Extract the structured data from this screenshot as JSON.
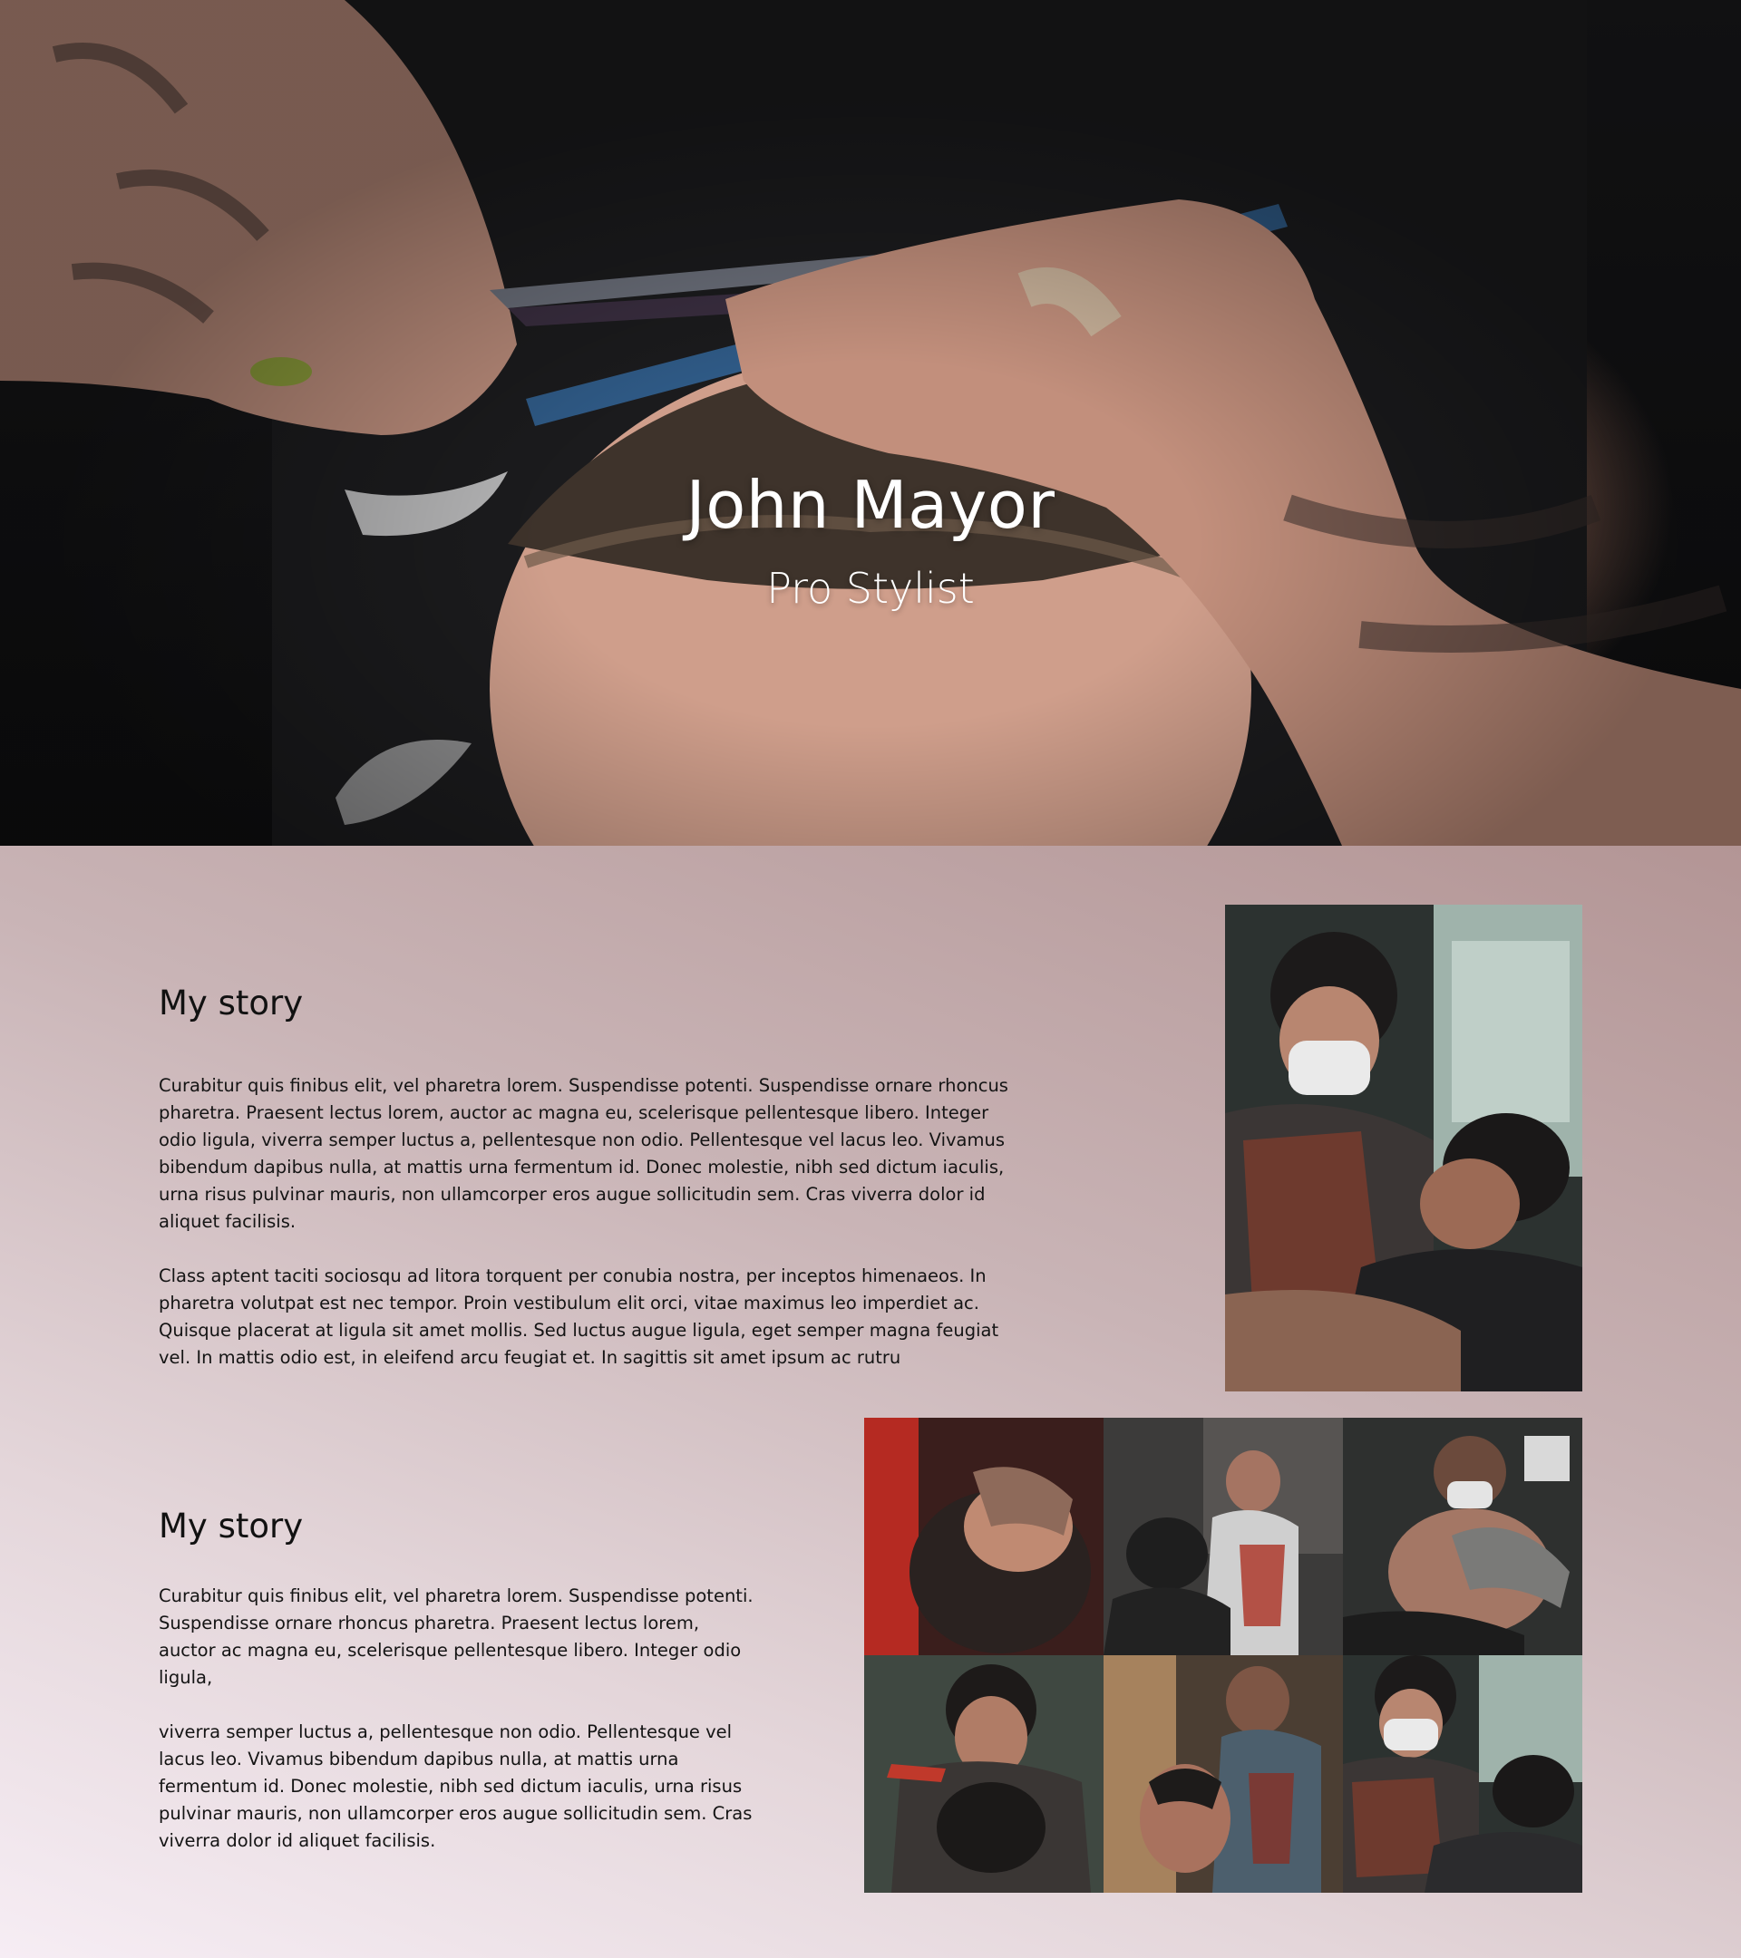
{
  "hero": {
    "title": "John Mayor",
    "subtitle": "Pro Stylist"
  },
  "story_1": {
    "heading": "My story",
    "paragraphs": [
      "Curabitur quis finibus elit, vel pharetra lorem. Suspendisse potenti. Suspendisse ornare rhoncus pharetra. Praesent lectus lorem, auctor ac magna eu, scelerisque pellentesque libero. Integer odio ligula, viverra semper luctus a, pellentesque non odio. Pellentesque vel lacus leo. Vivamus bibendum dapibus nulla, at mattis urna fermentum id. Donec molestie, nibh sed dictum iaculis, urna risus pulvinar mauris, non ullamcorper eros augue sollicitudin sem. Cras viverra dolor id aliquet facilisis.",
      "Class aptent taciti sociosqu ad litora torquent per conubia nostra, per inceptos himenaeos. In pharetra volutpat est nec tempor. Proin vestibulum elit orci, vitae maximus leo imperdiet ac. Quisque placerat at ligula sit amet mollis. Sed luctus augue ligula, eget semper magna feugiat vel. In mattis odio est, in eleifend arcu feugiat et. In sagittis sit amet ipsum ac rutru"
    ]
  },
  "story_2": {
    "heading": "My story",
    "paragraphs": [
      "Curabitur quis finibus elit, vel pharetra lorem. Suspendisse potenti. Suspendisse ornare rhoncus pharetra. Praesent lectus lorem, auctor ac magna eu, scelerisque pellentesque libero. Integer odio ligula,",
      "viverra semper luctus a, pellentesque non odio. Pellentesque vel lacus leo. Vivamus bibendum dapibus nulla, at mattis urna fermentum id. Donec molestie, nibh sed dictum iaculis, urna risus pulvinar mauris, non ullamcorper eros augue sollicitudin sem. Cras viverra dolor id aliquet facilisis."
    ]
  },
  "colors": {
    "hero_text": "#ffffff",
    "body_text": "#141414",
    "bg_gradient_light": "#f6edf4",
    "bg_gradient_dark": "#b39595"
  }
}
